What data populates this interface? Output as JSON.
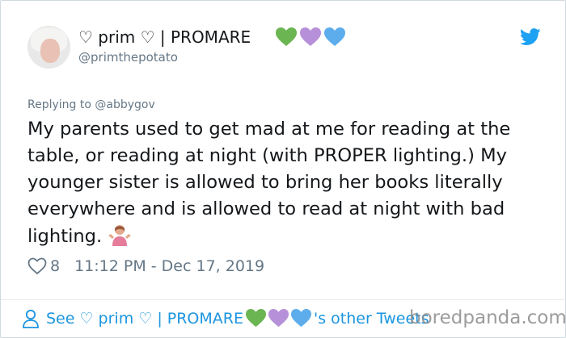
{
  "header": {
    "display_name": "♡ prim ♡ | PROMARE",
    "handle": "@primthepotato",
    "hearts": [
      {
        "icon": "green-heart-icon",
        "color": "#6bb552"
      },
      {
        "icon": "purple-heart-icon",
        "color": "#b690d9"
      },
      {
        "icon": "blue-heart-icon",
        "color": "#5dadec"
      }
    ]
  },
  "tweet": {
    "replying_to": "Replying to @abbygov",
    "text": "My parents used to get mad at me for reading at the table, or reading at night (with PROPER lighting.) My younger sister is allowed to bring her books literally everywhere and is allowed to read at night with bad lighting.",
    "emoji": "person-shrugging-icon"
  },
  "meta": {
    "likes": "8",
    "timestamp": "11:12 PM - Dec 17, 2019"
  },
  "footer": {
    "see_prefix": "See ♡ prim ♡ | PROMARE",
    "see_suffix": "'s other Tweets"
  },
  "watermark": "boredpanda.com",
  "colors": {
    "link": "#1b95e0",
    "muted": "#657786",
    "twitter_blue": "#1da1f2"
  }
}
